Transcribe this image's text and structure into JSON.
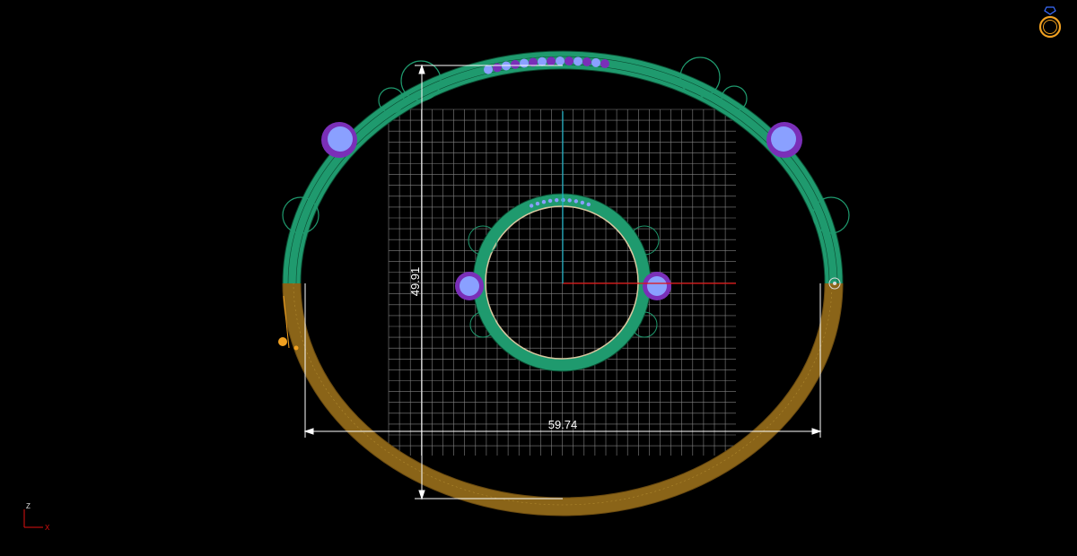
{
  "viewport": {
    "background": "#000000",
    "dimensions": {
      "width_value": "59.74",
      "height_value": "49.91"
    },
    "axis_labels": {
      "z": "Z",
      "x": "X"
    },
    "colors": {
      "grid": "#9a9a9a",
      "band_green": "#1f9a6e",
      "band_brown": "#8a6418",
      "stones_blue": "#7f90ff",
      "stones_purple": "#7a2fb8",
      "axis_red": "#e01010",
      "axis_cyan": "#1ab3c8",
      "dimension_line": "#ffffff",
      "accent_orange": "#f0a020"
    }
  },
  "view_cube": {
    "icon": "ring-icon",
    "color": "#f0a020"
  }
}
